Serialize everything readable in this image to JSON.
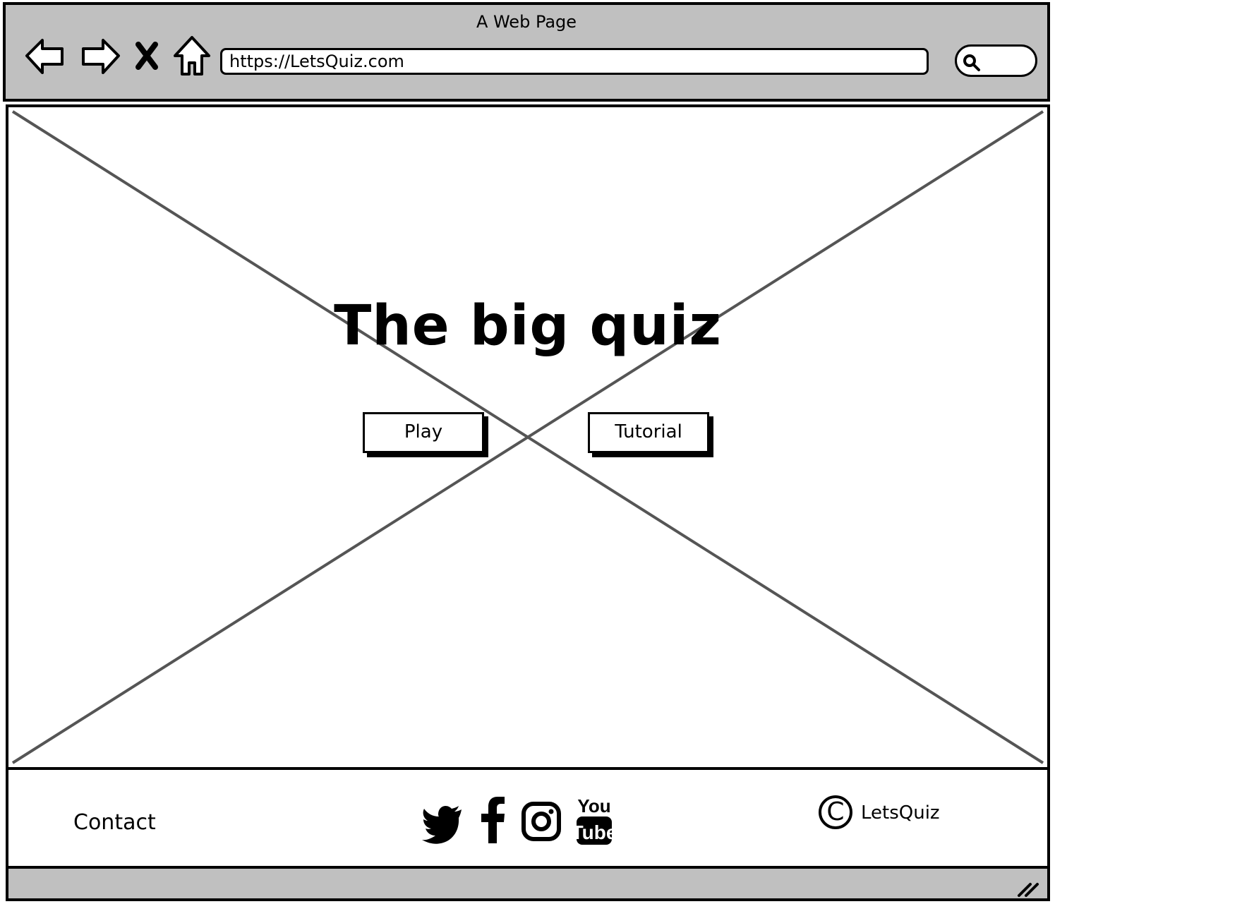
{
  "browser": {
    "window_title": "A Web Page",
    "url": "https://LetsQuiz.com",
    "nav": {
      "back": "back-arrow-icon",
      "forward": "forward-arrow-icon",
      "stop": "close-icon",
      "home": "home-icon"
    },
    "search_icon": "search-icon"
  },
  "hero": {
    "title": "The big quiz",
    "background": "image-placeholder",
    "buttons": {
      "play": "Play",
      "tutorial": "Tutorial"
    }
  },
  "footer": {
    "contact": "Contact",
    "social_icons": [
      "twitter-icon",
      "facebook-icon",
      "instagram-icon",
      "youtube-icon"
    ],
    "youtube_text_top": "You",
    "youtube_text_bottom": "Tube",
    "copyright_symbol": "C",
    "brand": "LetsQuiz"
  },
  "colors": {
    "chrome": "#c0c0c0",
    "stroke": "#000000",
    "placeholder_line": "#555555"
  }
}
